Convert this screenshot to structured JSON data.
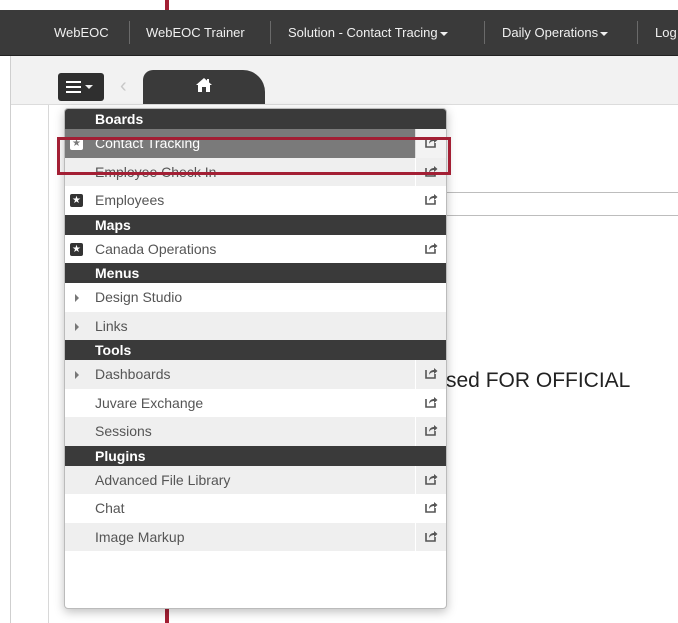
{
  "topbar": {
    "items": [
      {
        "label": "WebEOC",
        "dropdown": false
      },
      {
        "label": "WebEOC Trainer",
        "dropdown": false
      },
      {
        "label": "Solution - Contact Tracing",
        "dropdown": true
      },
      {
        "label": "Daily Operations",
        "dropdown": true
      },
      {
        "label": "Log",
        "dropdown": false
      }
    ]
  },
  "content": {
    "notice": "sed FOR OFFICIAL"
  },
  "menu": {
    "boards_header": "Boards",
    "boards": [
      {
        "label": "Contact Tracking",
        "favorite": true,
        "selected": true,
        "external": true
      },
      {
        "label": "Employee Check In",
        "favorite": false,
        "external": true
      },
      {
        "label": "Employees",
        "favorite": true,
        "external": true
      }
    ],
    "maps_header": "Maps",
    "maps": [
      {
        "label": "Canada Operations",
        "favorite": true,
        "external": true
      }
    ],
    "menus_header": "Menus",
    "menus": [
      {
        "label": "Design Studio",
        "expandable": true
      },
      {
        "label": "Links",
        "expandable": true
      }
    ],
    "tools_header": "Tools",
    "tools": [
      {
        "label": "Dashboards",
        "expandable": true,
        "external": true
      },
      {
        "label": "Juvare Exchange",
        "external": true
      },
      {
        "label": "Sessions",
        "external": true
      }
    ],
    "plugins_header": "Plugins",
    "plugins": [
      {
        "label": "Advanced File Library",
        "external": true
      },
      {
        "label": "Chat",
        "external": true
      },
      {
        "label": "Image Markup",
        "external": true
      }
    ]
  },
  "colors": {
    "topbar": "#3a3a3a",
    "highlight": "#a31f34",
    "selected_row": "#7a7a7a"
  }
}
